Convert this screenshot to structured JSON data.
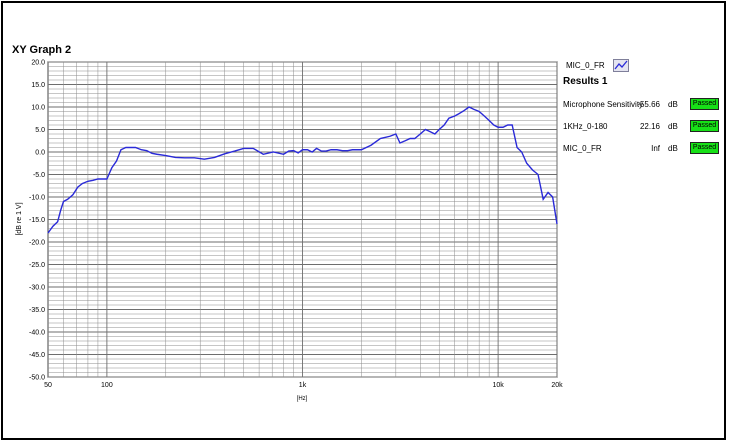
{
  "window": {
    "graph_title": "XY Graph 2"
  },
  "legend": {
    "series_label": "MIC_0_FR",
    "icon": "line-plot-icon"
  },
  "results": {
    "title": "Results 1",
    "rows": [
      {
        "name": "Microphone Sensitivity",
        "value": "-55.66",
        "unit": "dB",
        "status": "Passed"
      },
      {
        "name": "1KHz_0-180",
        "value": "22.16",
        "unit": "dB",
        "status": "Passed"
      },
      {
        "name": "MIC_0_FR",
        "value": "Inf",
        "unit": "dB",
        "status": "Passed"
      }
    ],
    "status_color": "#17e017"
  },
  "colors": {
    "series": "#2a2ad8",
    "grid": "#8c8c8c",
    "frame": "#000000"
  },
  "chart_data": {
    "type": "line",
    "xscale": "log",
    "xlim": [
      50,
      20000
    ],
    "ylim": [
      -50,
      20
    ],
    "xlabel": "[Hz]",
    "ylabel": "[dB re 1 V]",
    "grid": true,
    "x_ticks": [
      50,
      100,
      1000,
      10000,
      20000
    ],
    "x_tick_labels": [
      "50",
      "100",
      "1k",
      "10k",
      "20k"
    ],
    "y_ticks": [
      20,
      15,
      10,
      5,
      0,
      -5,
      -10,
      -15,
      -20,
      -25,
      -30,
      -35,
      -40,
      -45,
      -50
    ],
    "y_tick_labels": [
      "20.0",
      "15.0",
      "10.0",
      "5.0",
      "0.0",
      "-5.0",
      "-10.0",
      "-15.0",
      "-20.0",
      "-25.0",
      "-30.0",
      "-35.0",
      "-40.0",
      "-45.0",
      "-50.0"
    ],
    "series": [
      {
        "name": "MIC_0_FR",
        "x": [
          50,
          53,
          56,
          58,
          60,
          63,
          67,
          71,
          75,
          80,
          85,
          90,
          95,
          100,
          106,
          112,
          118,
          125,
          132,
          140,
          150,
          160,
          170,
          180,
          200,
          224,
          250,
          280,
          315,
          355,
          400,
          450,
          500,
          560,
          630,
          710,
          800,
          850,
          900,
          950,
          1000,
          1060,
          1120,
          1180,
          1250,
          1320,
          1400,
          1500,
          1600,
          1700,
          1800,
          2000,
          2240,
          2500,
          2800,
          3000,
          3150,
          3350,
          3550,
          3750,
          4000,
          4250,
          4500,
          4750,
          5000,
          5300,
          5600,
          6000,
          6300,
          6700,
          7100,
          7500,
          8000,
          8500,
          9000,
          9500,
          10000,
          10600,
          11200,
          11800,
          12500,
          13200,
          14000,
          15000,
          16000,
          17000,
          18000,
          19000,
          20000
        ],
        "y": [
          -18,
          -16.5,
          -15.5,
          -13,
          -11,
          -10.5,
          -9.5,
          -7.8,
          -7,
          -6.5,
          -6.3,
          -6,
          -6,
          -6,
          -3.5,
          -2,
          0.5,
          1,
          1,
          1,
          0.5,
          0.3,
          -0.3,
          -0.5,
          -0.8,
          -1.2,
          -1.3,
          -1.3,
          -1.6,
          -1.2,
          -0.4,
          0.2,
          0.8,
          0.8,
          -0.5,
          0,
          -0.5,
          0.2,
          0.3,
          -0.2,
          0.5,
          0.5,
          0,
          0.8,
          0.2,
          0.2,
          0.5,
          0.5,
          0.3,
          0.3,
          0.5,
          0.5,
          1.5,
          3,
          3.5,
          4,
          2,
          2.5,
          3,
          3,
          4,
          5,
          4.5,
          4,
          5,
          6,
          7.5,
          8,
          8.5,
          9.2,
          10,
          9.5,
          9,
          8,
          7,
          6,
          5.5,
          5.5,
          6,
          6,
          1,
          0,
          -2.5,
          -4,
          -5,
          -10.5,
          -9,
          -10,
          -16
        ]
      }
    ]
  }
}
